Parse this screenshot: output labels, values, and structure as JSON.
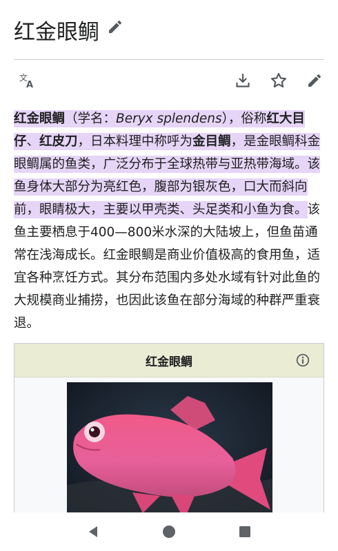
{
  "page": {
    "title": "红金眼鲷"
  },
  "toolbar": {
    "language_icon": "translate-icon",
    "download_icon": "download-icon",
    "star_icon": "star-icon",
    "edit_icon": "edit-pencil-icon"
  },
  "article": {
    "lead": {
      "s1": "红金眼鲷",
      "s2": "（学名：",
      "s3": "Beryx splendens",
      "s4": "），俗称",
      "s5": "红大目仔",
      "s6": "、",
      "s7": "红皮刀",
      "s8": "，日本料理中称呼为",
      "s9": "金目鲷",
      "s10": "，是金眼鲷科金眼鲷属的鱼类，广泛分布于全球热带与亚热带海域。该鱼身体大部分为亮红色，腹部为银灰色，口大而斜向前，眼睛极大，主要以甲壳类、头足类和小鱼为食。"
    },
    "rest": "该鱼主要栖息于400—800米水深的大陆坡上，但鱼苗通常在浅海成长。红金眼鲷是商业价值极高的食用鱼，适宜各种烹饪方式。其分布范围内多处水域有针对此鱼的大规模商业捕捞，也因此该鱼在部分海域的种群严重衰退。"
  },
  "infobox": {
    "title": "红金眼鲷",
    "info_icon": "info-icon"
  },
  "navbar": {
    "back_icon": "back-triangle-icon",
    "home_icon": "home-circle-icon",
    "recents_icon": "recents-square-icon"
  },
  "colors": {
    "highlight": "#e6d5f7",
    "infobox_header": "#eaecd4",
    "text": "#202122",
    "icon": "#54595d"
  }
}
